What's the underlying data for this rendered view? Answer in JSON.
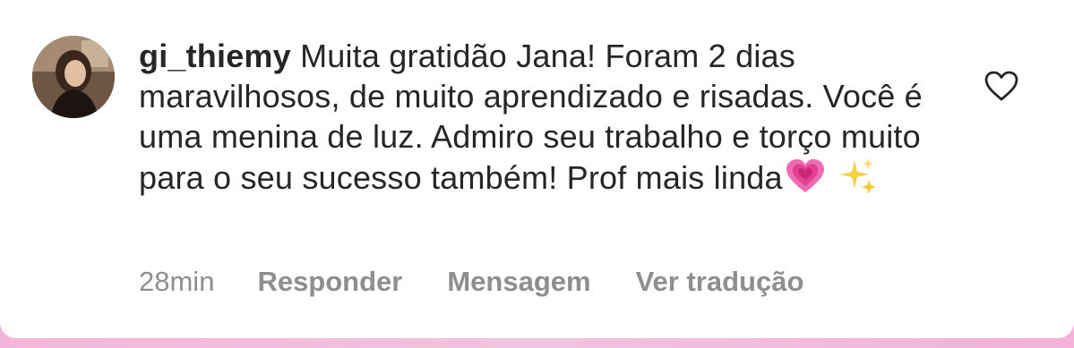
{
  "comment": {
    "username": "gi_thiemy",
    "text": "Muita gratidão Jana! Foram 2 dias maravilhosos, de muito aprendizado e risadas. Você é uma menina de luz. Admiro seu trabalho e torço muito para o seu sucesso também! Prof mais linda",
    "emojis": [
      "growing-heart-emoji",
      "sparkles-emoji"
    ]
  },
  "meta": {
    "time": "28min",
    "reply_label": "Responder",
    "message_label": "Mensagem",
    "translate_label": "Ver tradução"
  },
  "icons": {
    "like": "heart-outline-icon",
    "avatar": "profile-photo"
  },
  "colors": {
    "text": "#262626",
    "secondary": "#8e8e8e",
    "background_accent": "#f0c4e0"
  }
}
